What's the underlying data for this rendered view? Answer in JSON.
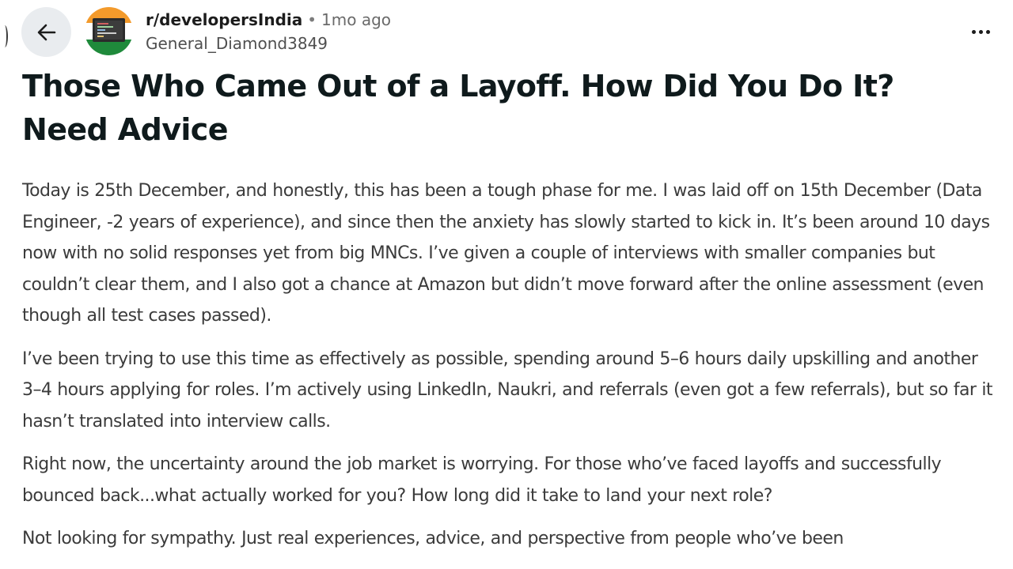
{
  "header": {
    "subreddit": "r/developersIndia",
    "separator": "•",
    "time_ago": "1mo ago",
    "username": "General_Diamond3849",
    "icons": {
      "back": "arrow-left-icon",
      "more": "more-horizontal-icon",
      "avatar": "subreddit-avatar-icon"
    }
  },
  "post": {
    "title": "Those Who Came Out of a Layoff. How Did You Do It? Need Advice",
    "paragraphs": [
      "Today is 25th December, and honestly, this has been a tough phase for me. I was laid off on 15th December (Data Engineer, -2 years of experience), and since then the anxiety has slowly started to kick in. It’s been around 10 days now with no solid responses yet from big MNCs. I’ve given a couple of interviews with smaller companies but couldn’t clear them, and I also got a chance at Amazon but didn’t move forward after the online assessment (even though all test cases passed).",
      "I’ve been trying to use this time as effectively as possible, spending around 5–6 hours daily upskilling and another 3–4 hours applying for roles. I’m actively using LinkedIn, Naukri, and referrals (even got a few referrals), but so far it hasn’t translated into interview calls.",
      "Right now, the uncertainty around the job market is worrying. For those who’ve faced layoffs and successfully bounced back...what actually worked for you? How long did it take to land your next role?",
      "Not looking for sympathy. Just real experiences, advice, and perspective from people who’ve been"
    ]
  },
  "colors": {
    "india_saffron": "#f39a2b",
    "india_green": "#1f8a3b",
    "back_button_bg": "#e9ecef"
  }
}
